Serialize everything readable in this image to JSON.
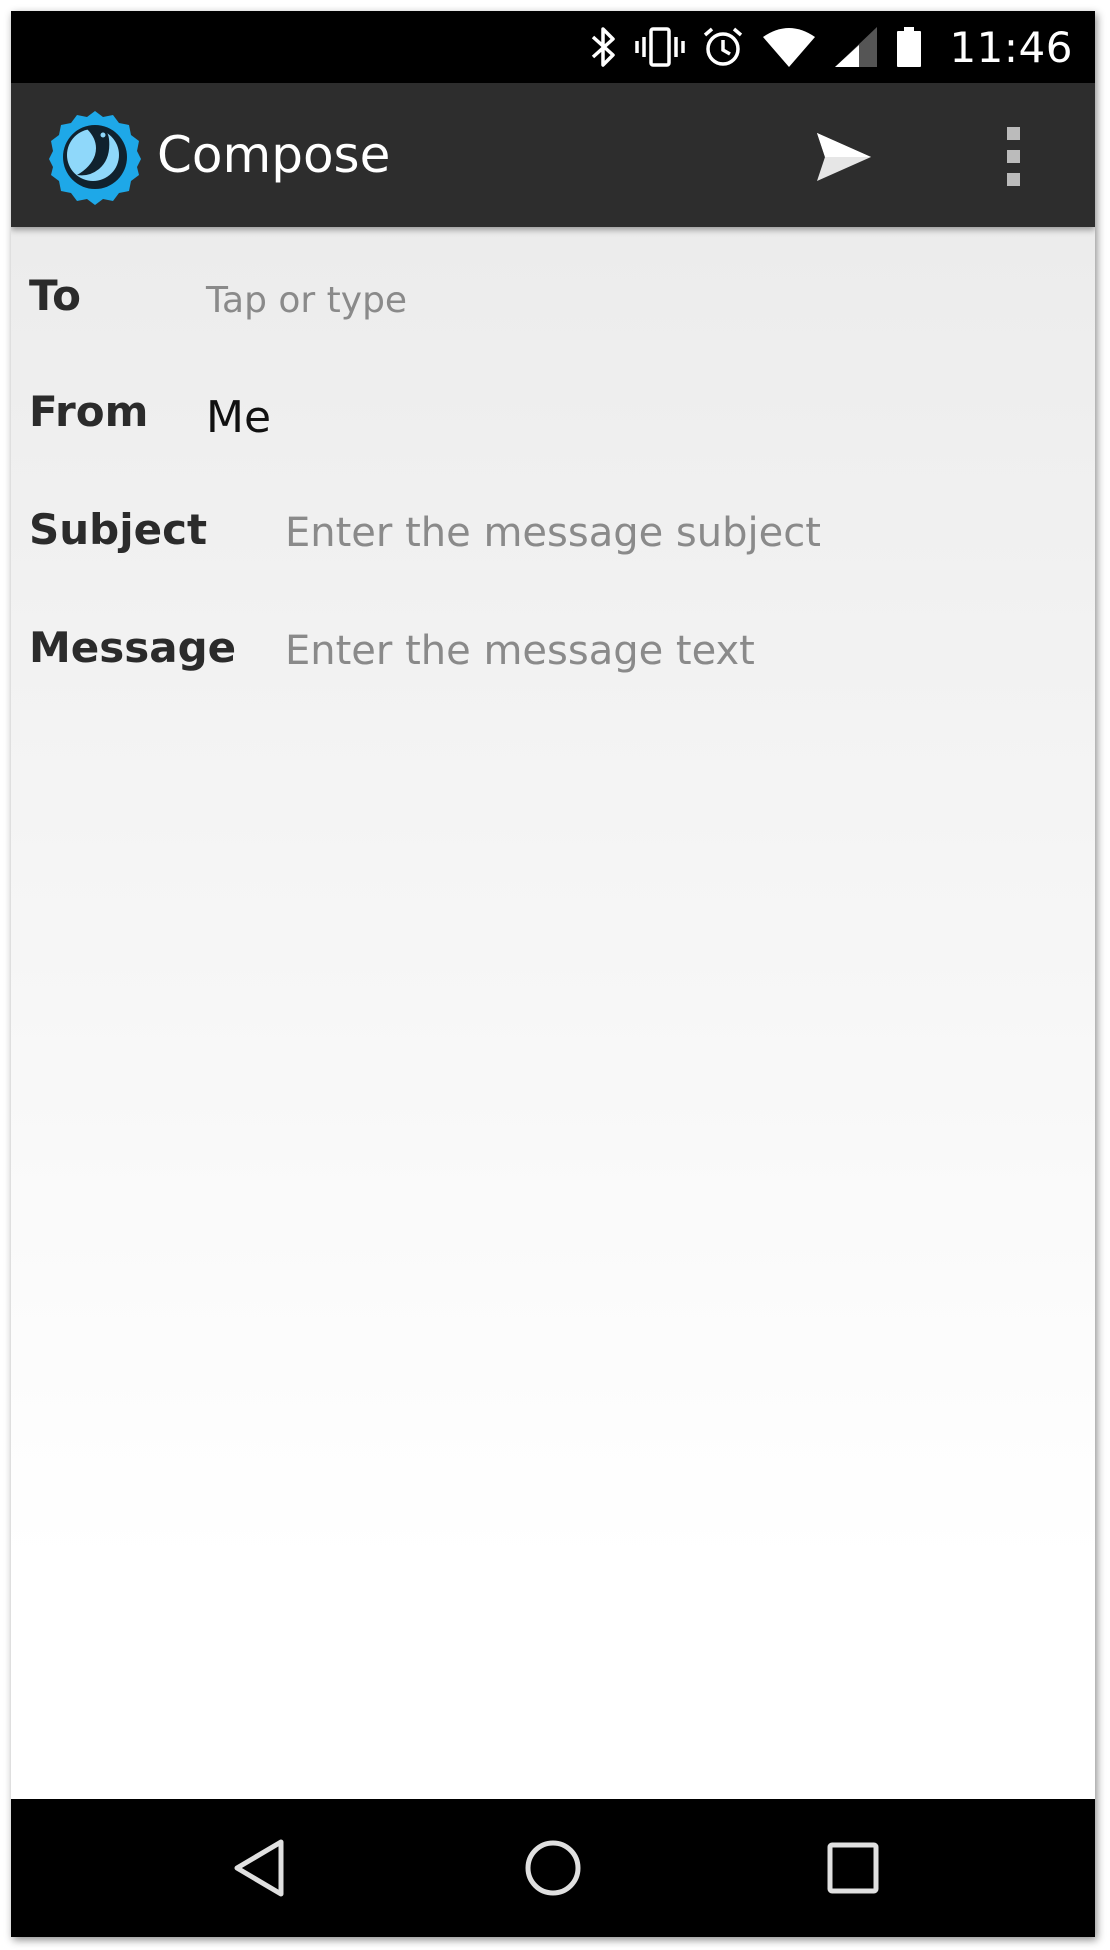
{
  "status_bar": {
    "time": "11:46",
    "icons": [
      "bluetooth-icon",
      "vibrate-icon",
      "alarm-icon",
      "wifi-icon",
      "signal-icon",
      "battery-icon"
    ]
  },
  "app_bar": {
    "title": "Compose",
    "logo": "app-logo-icon",
    "actions": [
      "send-icon",
      "overflow-menu-icon"
    ]
  },
  "form": {
    "to": {
      "label": "To",
      "placeholder": "Tap or type"
    },
    "from": {
      "label": "From",
      "value": "Me"
    },
    "subject": {
      "label": "Subject",
      "placeholder": "Enter the message subject"
    },
    "message": {
      "label": "Message",
      "placeholder": "Enter the message text"
    }
  },
  "nav_bar": {
    "buttons": [
      "back-icon",
      "home-icon",
      "recents-icon"
    ]
  },
  "colors": {
    "app_bar": "#2d2d2d",
    "status_bar": "#000000",
    "logo_blue": "#1ea8e8",
    "placeholder": "#8a8a8a",
    "label": "#2b2b2b"
  }
}
